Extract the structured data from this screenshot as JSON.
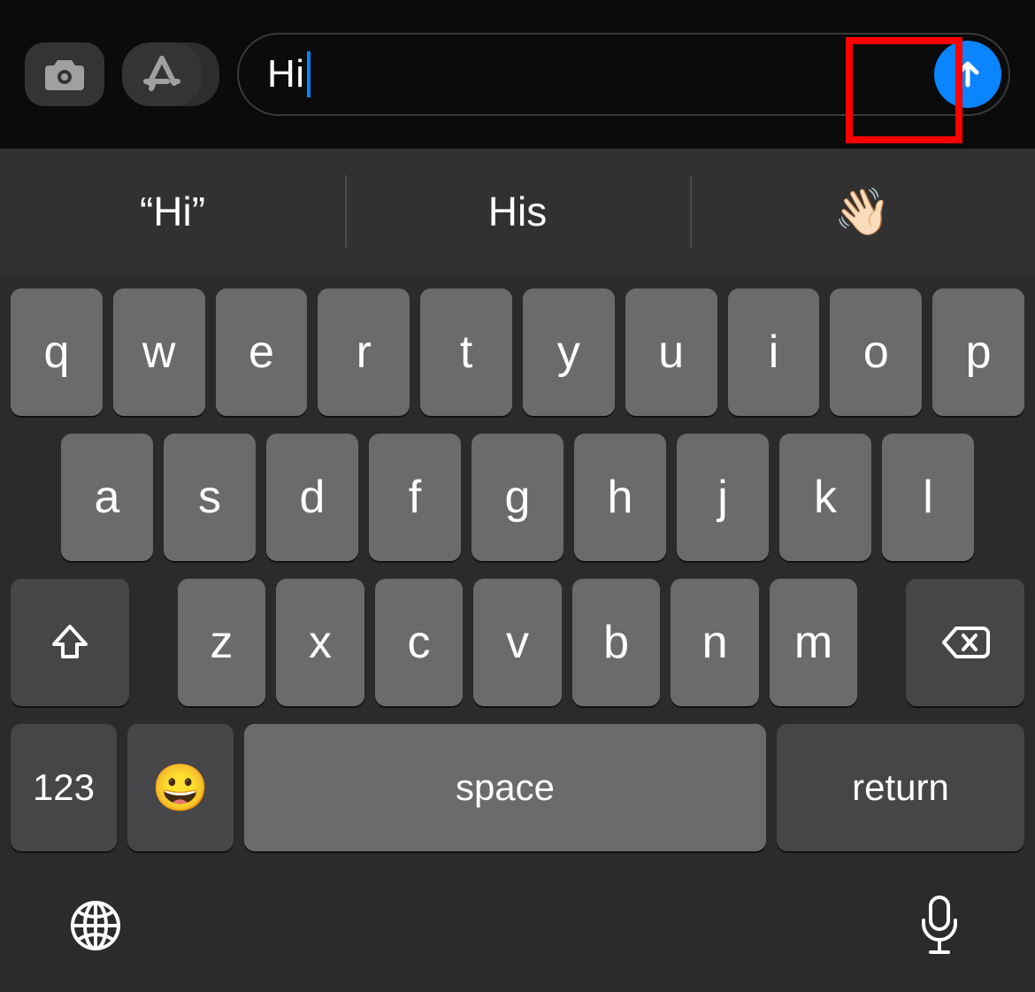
{
  "input": {
    "value": "Hi"
  },
  "suggestions": {
    "s1": "“Hi”",
    "s2": "His",
    "s3": "👋🏻"
  },
  "keys": {
    "row1": {
      "k0": "q",
      "k1": "w",
      "k2": "e",
      "k3": "r",
      "k4": "t",
      "k5": "y",
      "k6": "u",
      "k7": "i",
      "k8": "o",
      "k9": "p"
    },
    "row2": {
      "k0": "a",
      "k1": "s",
      "k2": "d",
      "k3": "f",
      "k4": "g",
      "k5": "h",
      "k6": "j",
      "k7": "k",
      "k8": "l"
    },
    "row3": {
      "k0": "z",
      "k1": "x",
      "k2": "c",
      "k3": "v",
      "k4": "b",
      "k5": "n",
      "k6": "m"
    },
    "num": "123",
    "space": "space",
    "return": "return",
    "emoji": "😀"
  },
  "colors": {
    "accent": "#0a84ff",
    "highlight": "#ff0000"
  }
}
